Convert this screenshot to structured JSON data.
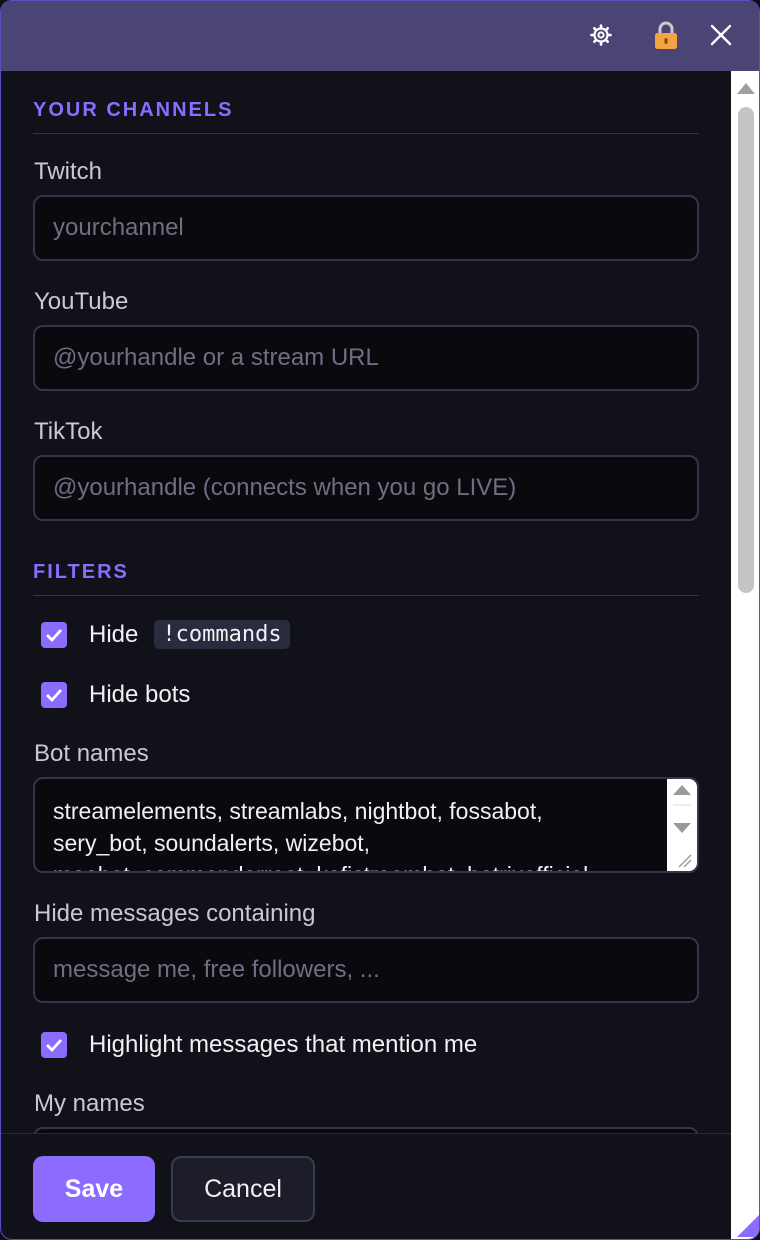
{
  "titlebar": {
    "icons": [
      "gear-icon",
      "lock-icon",
      "close-icon"
    ],
    "accent": "#4a4574"
  },
  "channels": {
    "heading": "YOUR CHANNELS",
    "twitch": {
      "label": "Twitch",
      "placeholder": "yourchannel",
      "value": ""
    },
    "youtube": {
      "label": "YouTube",
      "placeholder": "@yourhandle or a stream URL",
      "value": ""
    },
    "tiktok": {
      "label": "TikTok",
      "placeholder": "@yourhandle (connects when you go LIVE)",
      "value": ""
    }
  },
  "filters": {
    "heading": "FILTERS",
    "hide_commands": {
      "label": "Hide",
      "chip": "!commands",
      "checked": true
    },
    "hide_bots": {
      "label": "Hide bots",
      "checked": true
    },
    "bot_names": {
      "label": "Bot names",
      "value": "streamelements, streamlabs, nightbot, fossabot,\nsery_bot, soundalerts, wizebot,\nmoobot, commanderroot, kofistreambot, botrixofficial"
    },
    "hide_messages": {
      "label": "Hide messages containing",
      "placeholder": "message me, free followers, ...",
      "value": ""
    },
    "highlight_mentions": {
      "label": "Highlight messages that mention me",
      "checked": true
    },
    "my_names": {
      "label": "My names"
    }
  },
  "footer": {
    "save_label": "Save",
    "cancel_label": "Cancel"
  },
  "colors": {
    "accent": "#8b6cff",
    "background": "#111219",
    "input_bg": "#09090e"
  }
}
